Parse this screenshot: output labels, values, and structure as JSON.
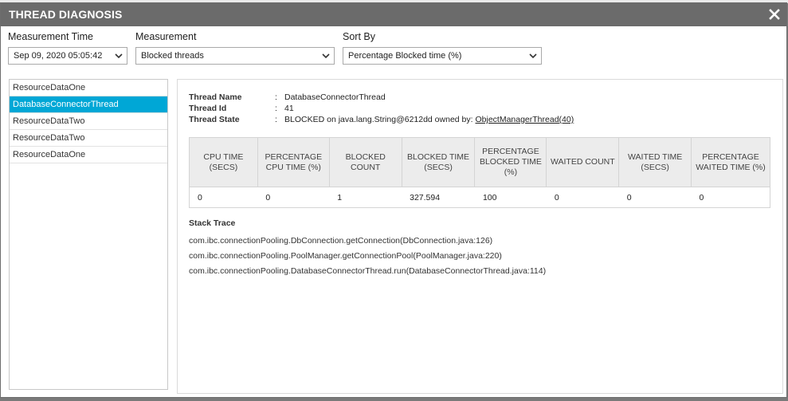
{
  "dialog": {
    "title": "THREAD DIAGNOSIS"
  },
  "filters": {
    "measurement_time_label": "Measurement Time",
    "measurement_time_value": "Sep 09, 2020 05:05:42",
    "measurement_label": "Measurement",
    "measurement_value": "Blocked threads",
    "sort_by_label": "Sort By",
    "sort_by_value": "Percentage Blocked time (%)"
  },
  "threads": [
    {
      "label": "ResourceDataOne",
      "selected": false
    },
    {
      "label": "DatabaseConnectorThread",
      "selected": true
    },
    {
      "label": "ResourceDataTwo",
      "selected": false
    },
    {
      "label": "ResourceDataTwo",
      "selected": false
    },
    {
      "label": "ResourceDataOne",
      "selected": false
    }
  ],
  "details": {
    "separator": ":",
    "thread_name_label": "Thread Name",
    "thread_name_value": "DatabaseConnectorThread",
    "thread_id_label": "Thread Id",
    "thread_id_value": "41",
    "thread_state_label": "Thread State",
    "thread_state_prefix": "BLOCKED on java.lang.String@6212dd owned by:",
    "thread_state_owner": "ObjectManagerThread",
    "thread_state_owner_id": "(40)"
  },
  "metrics": {
    "headers": [
      "CPU TIME (SECS)",
      "PERCENTAGE CPU TIME (%)",
      "BLOCKED COUNT",
      "BLOCKED TIME (SECS)",
      "PERCENTAGE BLOCKED TIME (%)",
      "WAITED COUNT",
      "WAITED TIME (SECS)",
      "PERCENTAGE WAITED TIME (%)"
    ],
    "values": [
      "0",
      "0",
      "1",
      "327.594",
      "100",
      "0",
      "0",
      "0"
    ]
  },
  "stack_trace": {
    "title": "Stack Trace",
    "lines": [
      "com.ibc.connectionPooling.DbConnection.getConnection(DbConnection.java:126)",
      "com.ibc.connectionPooling.PoolManager.getConnectionPool(PoolManager.java:220)",
      "com.ibc.connectionPooling.DatabaseConnectorThread.run(DatabaseConnectorThread.java:114)"
    ]
  },
  "colors": {
    "titlebar": "#6b6b6b",
    "selected_row": "#00a7d6",
    "table_header": "#ececec"
  },
  "icons": {
    "close": "close-icon",
    "dropdown": "chevron-down-icon"
  }
}
